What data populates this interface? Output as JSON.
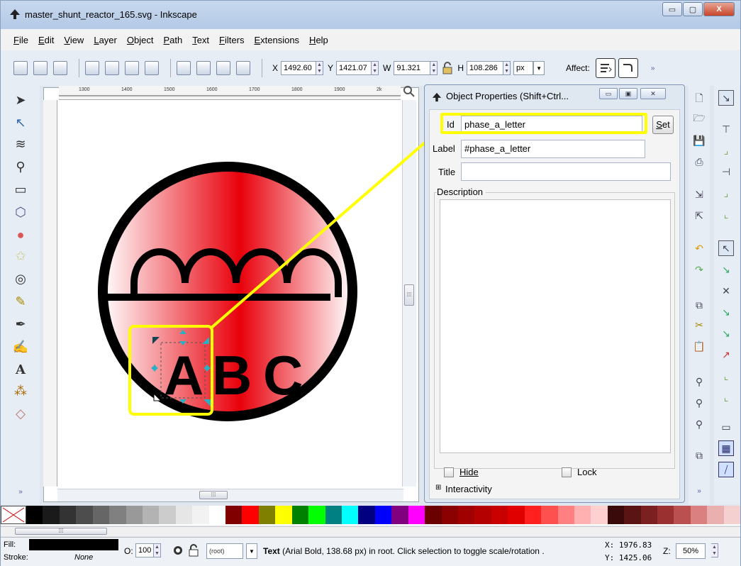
{
  "window": {
    "title": "master_shunt_reactor_165.svg - Inkscape",
    "controls": {
      "minimize": "▭",
      "maximize": "▢",
      "close": "X"
    }
  },
  "menu": [
    "File",
    "Edit",
    "View",
    "Layer",
    "Object",
    "Path",
    "Text",
    "Filters",
    "Extensions",
    "Help"
  ],
  "toolbar": {
    "x_label": "X",
    "x_value": "1492.60",
    "y_label": "Y",
    "y_value": "1421.07",
    "w_label": "W",
    "w_value": "91.321",
    "h_label": "H",
    "h_value": "108.286",
    "unit": "px",
    "affect_label": "Affect:",
    "overflow": "»"
  },
  "canvas": {
    "ruler_marks": [
      "1300",
      "1400",
      "1500",
      "1600",
      "1700",
      "1800",
      "1900",
      "2k"
    ],
    "letters": [
      "A",
      "B",
      "C"
    ],
    "grip": "⁞⁞⁞"
  },
  "dialog": {
    "title": "Object Properties (Shift+Ctrl...",
    "id_label": "Id",
    "id_value": "phase_a_letter",
    "set_label": "Set",
    "label_label": "Label",
    "label_value": "#phase_a_letter",
    "title_label": "Title",
    "title_value": "",
    "description_label": "Description",
    "hide_label": "Hide",
    "lock_label": "Lock",
    "interactivity_label": "Interactivity",
    "expand_glyph": "⊞"
  },
  "status": {
    "fill_label": "Fill:",
    "stroke_label": "Stroke:",
    "stroke_value": "None",
    "opacity_label": "O:",
    "opacity_value": "100",
    "layer_value": "(root)",
    "message_bold": "Text",
    "message": " (Arial Bold, 138.68 px) in root. Click selection to toggle scale/rotation .",
    "x_coord": "X: 1976.83",
    "y_coord": "Y: 1425.06",
    "zoom_label": "Z:",
    "zoom_value": "50%"
  },
  "colors": {
    "highlight": "#ffff00",
    "accent_red": "#e8000b",
    "selection_handle": "#2ab0c5"
  },
  "palette": [
    "#000000",
    "#1a1a1a",
    "#333333",
    "#4d4d4d",
    "#666666",
    "#808080",
    "#999999",
    "#b3b3b3",
    "#cccccc",
    "#e6e6e6",
    "#f2f2f2",
    "#ffffff",
    "#800000",
    "#ff0000",
    "#808000",
    "#ffff00",
    "#008000",
    "#00ff00",
    "#008080",
    "#00ffff",
    "#000080",
    "#0000ff",
    "#800080",
    "#ff00ff",
    "#6b0000",
    "#8b0000",
    "#a00000",
    "#b50000",
    "#c80000",
    "#e00000",
    "#ff2020",
    "#ff5050",
    "#ff8080",
    "#ffb0b0",
    "#ffd0d0",
    "#3a0a0a",
    "#5a1414",
    "#7a2020",
    "#9a3030",
    "#ba5050",
    "#da8080",
    "#eab0b0",
    "#f4d0d0"
  ]
}
